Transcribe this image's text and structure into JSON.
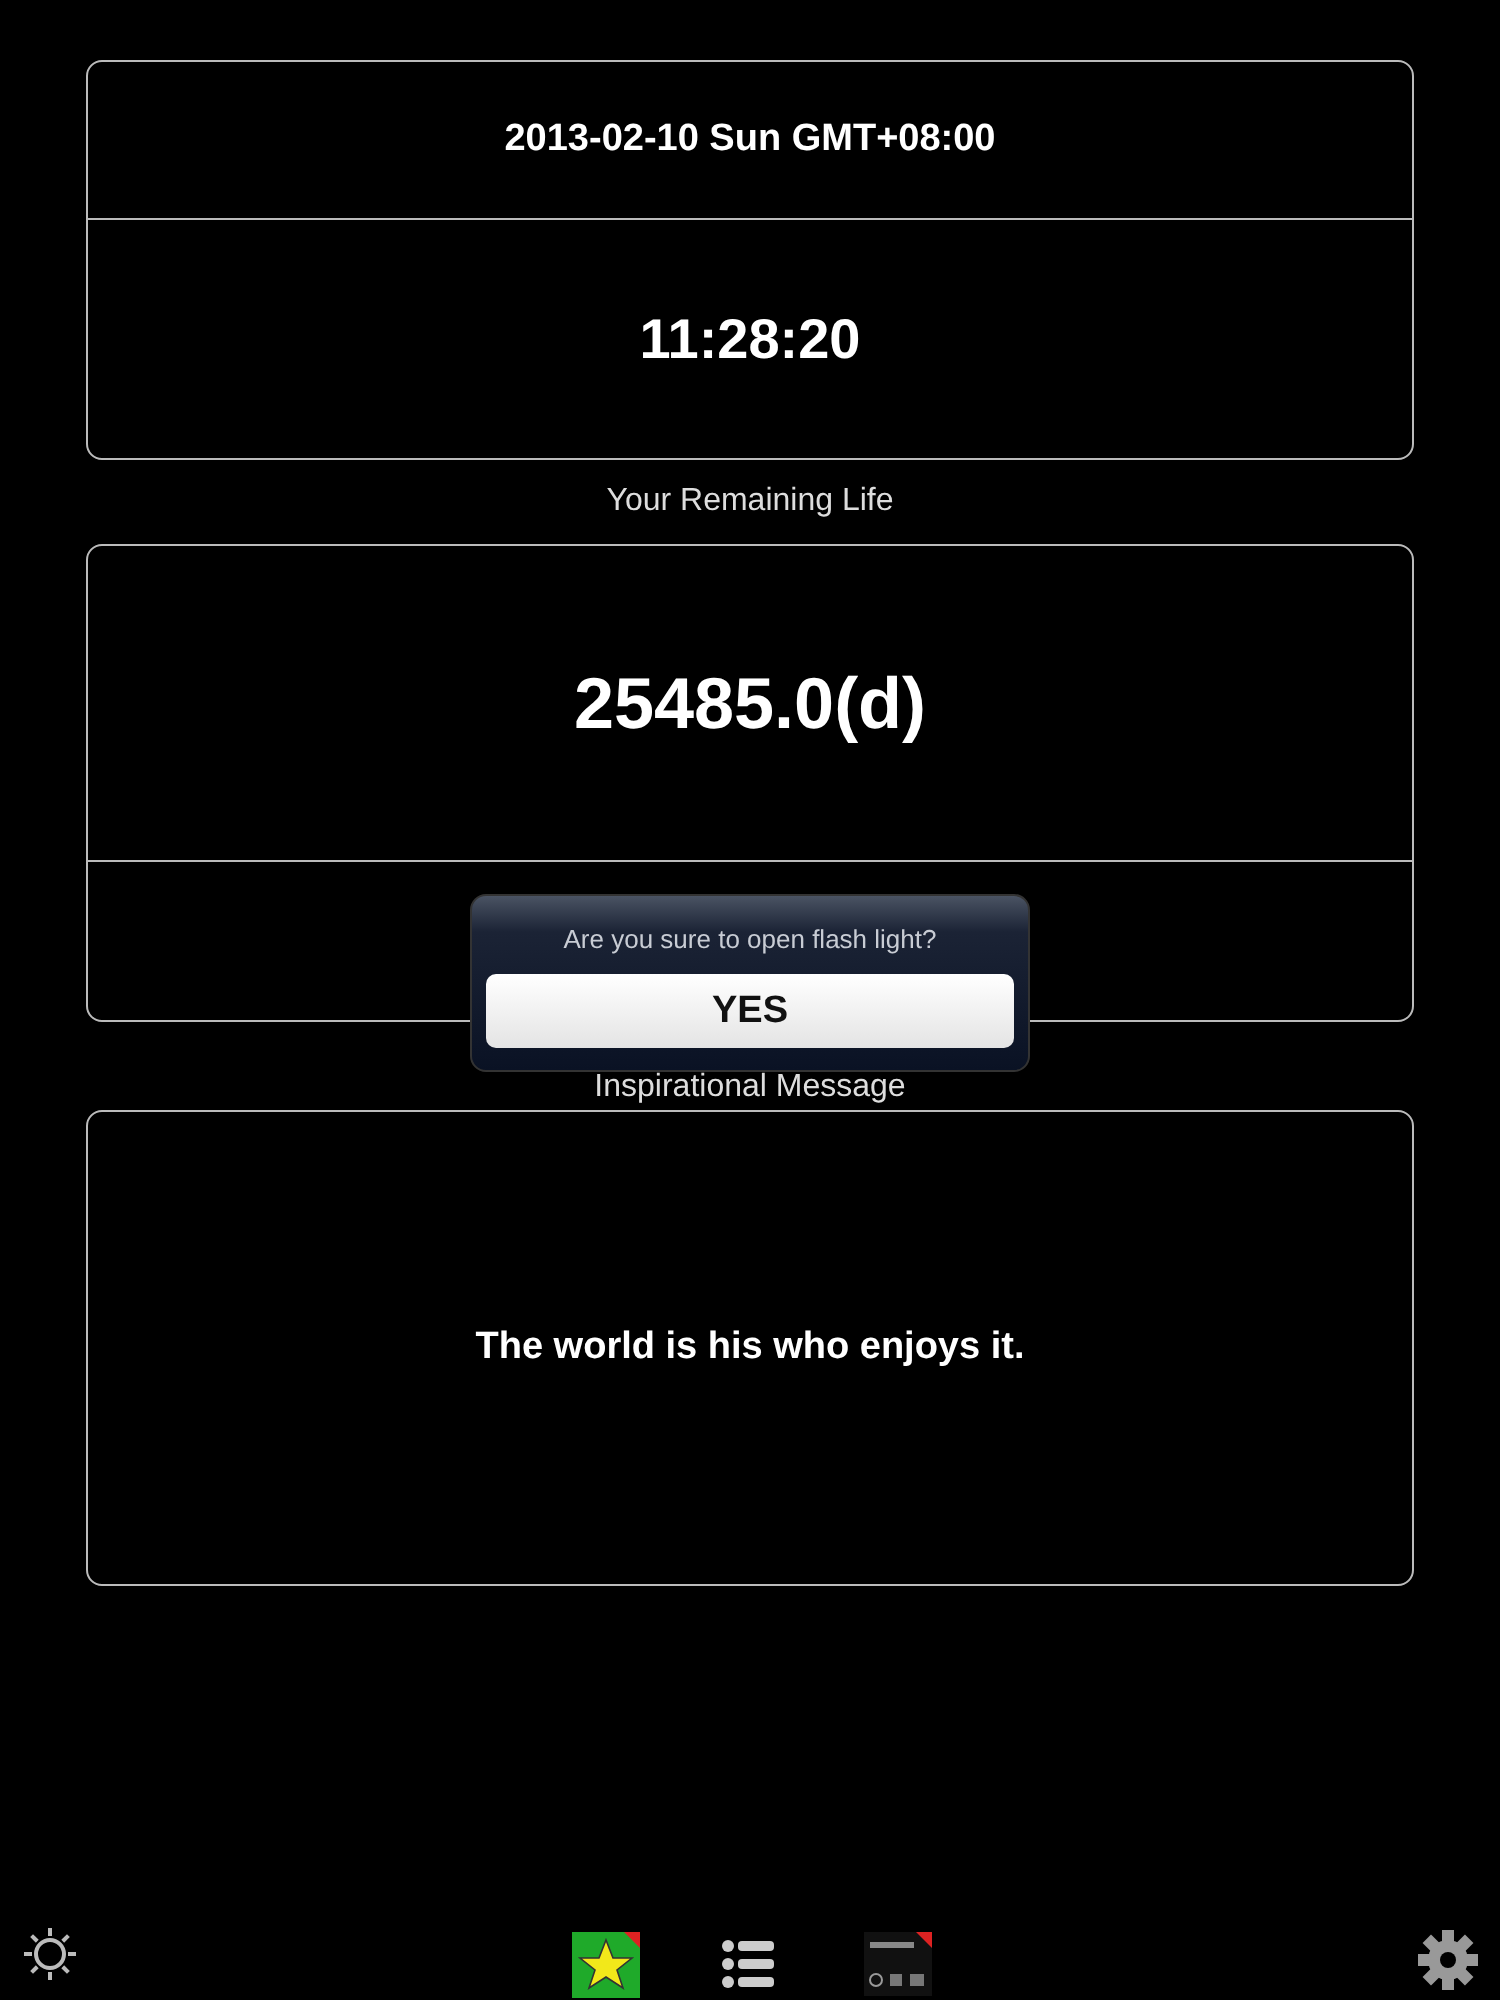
{
  "date_card": {
    "date": "2013-02-10 Sun GMT+08:00",
    "time": "11:28:20"
  },
  "remaining": {
    "label": "Your Remaining Life",
    "value": "25485.0(d)"
  },
  "message": {
    "label": "Inspirational Message",
    "text": "The world is his who enjoys it."
  },
  "popover": {
    "prompt": "Are you sure to open flash light?",
    "button": "YES"
  }
}
